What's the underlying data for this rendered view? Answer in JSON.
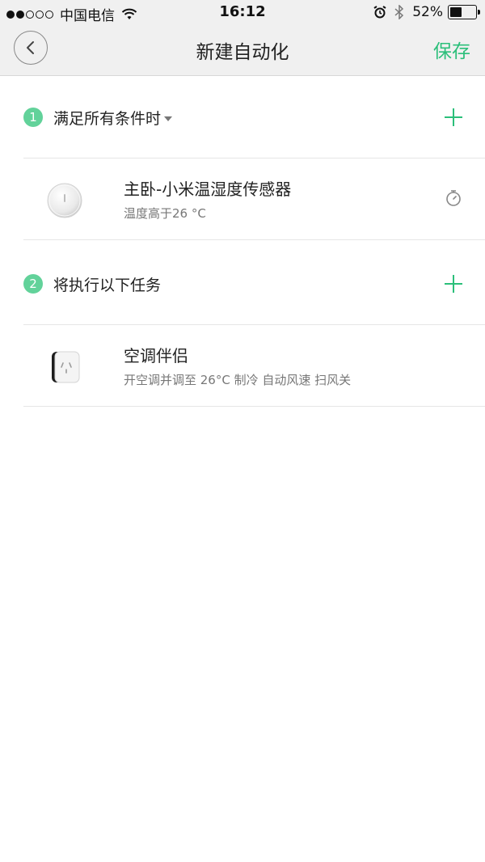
{
  "status_bar": {
    "carrier": "中国电信",
    "time": "16:12",
    "battery": "52%",
    "battery_level": 0.52,
    "icons": [
      "signal-dots",
      "wifi-icon",
      "alarm-icon",
      "bluetooth-icon",
      "battery-icon"
    ]
  },
  "header": {
    "title": "新建自动化",
    "save_label": "保存",
    "back_icon": "chevron-left-icon"
  },
  "colors": {
    "accent": "#2bbf7a",
    "badge": "#62d29a",
    "header_bg": "#f0f0f0"
  },
  "conditions": {
    "number": "1",
    "label": "满足所有条件时",
    "device": {
      "name": "主卧-小米温湿度传感器",
      "description": "温度高于26 °C",
      "icon": "temperature-sensor-icon"
    }
  },
  "actions": {
    "number": "2",
    "label": "将执行以下任务",
    "device": {
      "name": "空调伴侣",
      "description": "开空调并调至 26°C 制冷 自动风速 扫风关",
      "icon": "ac-companion-plug-icon"
    }
  }
}
